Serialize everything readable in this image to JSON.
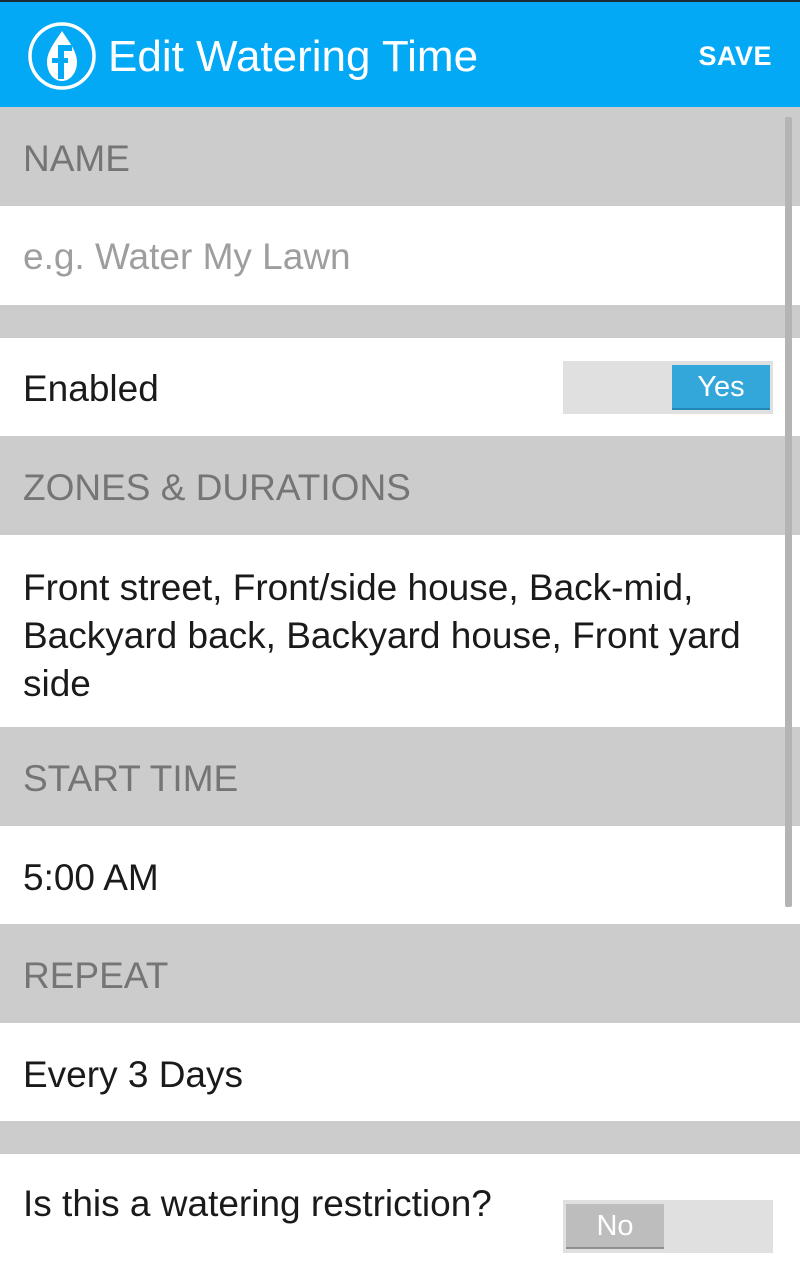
{
  "app_bar": {
    "title": "Edit Watering Time",
    "save_label": "SAVE",
    "logo_icon": "droplet-f-logo-icon",
    "color": "#03a9f4"
  },
  "sections": {
    "name_header": "NAME",
    "name_placeholder": "e.g. Water My Lawn",
    "enabled_label": "Enabled",
    "enabled_toggle": "Yes",
    "zones_header": "ZONES & DURATIONS",
    "zones_value": "Front street, Front/side house, Back-mid, Backyard back, Backyard house, Front yard side",
    "start_time_header": "START TIME",
    "start_time_value": "5:00 AM",
    "repeat_header": "REPEAT",
    "repeat_value": "Every 3 Days",
    "restriction_label": "Is this a watering restriction?",
    "restriction_toggle": "No"
  },
  "colors": {
    "section_background": "#cccccc",
    "toggle_on": "#33a7d9",
    "toggle_off": "#bdbdbd"
  }
}
